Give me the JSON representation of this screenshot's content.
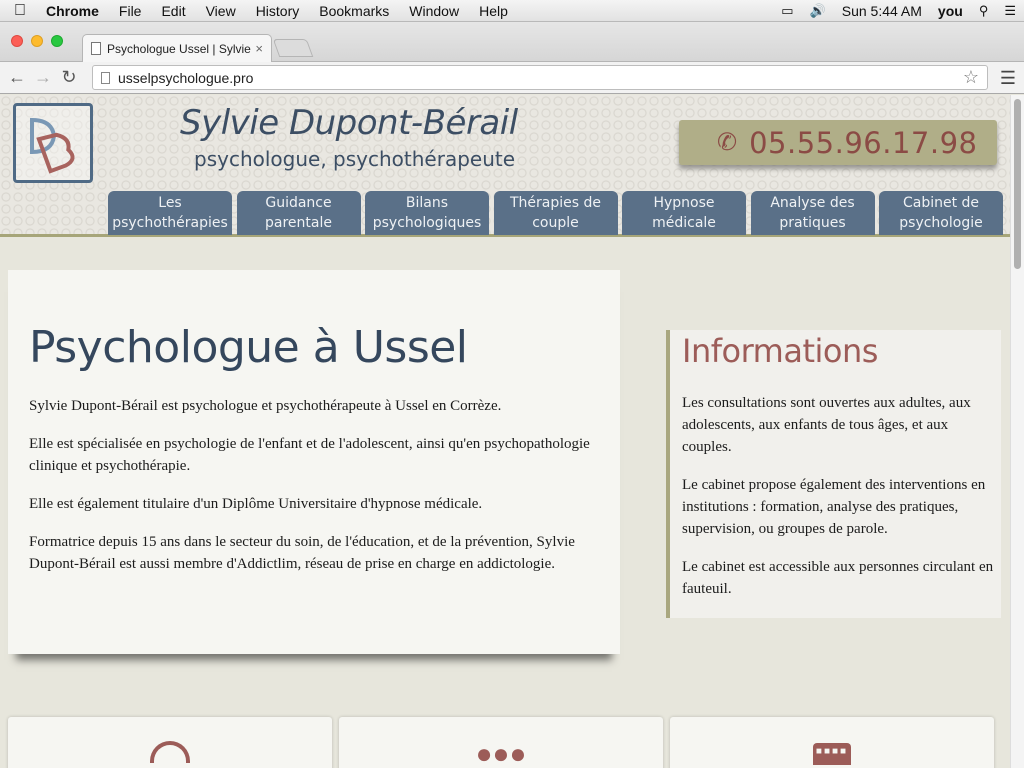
{
  "os_menubar": {
    "app_name": "Chrome",
    "menus": [
      "File",
      "Edit",
      "View",
      "History",
      "Bookmarks",
      "Window",
      "Help"
    ],
    "clock": "Sun 5:44 AM",
    "user": "you"
  },
  "browser": {
    "tab_title": "Psychologue Ussel | Sylvie",
    "tab_close": "×",
    "url": "usselpsychologue.pro"
  },
  "site": {
    "name": "Sylvie Dupont-Bérail",
    "tagline": "psychologue, psychothérapeute",
    "phone": "05.55.96.17.98",
    "logo_letters": "DB",
    "nav": [
      {
        "line1": "Les",
        "line2": "psychothérapies"
      },
      {
        "line1": "Guidance",
        "line2": "parentale"
      },
      {
        "line1": "Bilans",
        "line2": "psychologiques"
      },
      {
        "line1": "Thérapies de",
        "line2": "couple"
      },
      {
        "line1": "Hypnose",
        "line2": "médicale"
      },
      {
        "line1": "Analyse des",
        "line2": "pratiques"
      },
      {
        "line1": "Cabinet de",
        "line2": "psychologie"
      }
    ]
  },
  "main": {
    "title": "Psychologue à Ussel",
    "paragraphs": [
      "Sylvie Dupont-Bérail est psychologue et psychothérapeute à Ussel en Corrèze.",
      "Elle est spécialisée en psychologie de l'enfant et de l'adolescent, ainsi qu'en psychopathologie clinique et psychothérapie.",
      "Elle est également titulaire d'un Diplôme Universitaire d'hypnose médicale.",
      "Formatrice depuis 15 ans dans le secteur du soin, de l'éducation, et de la prévention, Sylvie Dupont-Bérail est aussi membre d'Addictlim, réseau de prise en charge en addictologie."
    ]
  },
  "info": {
    "title": "Informations",
    "paragraphs": [
      "Les consultations sont ouvertes aux adultes, aux adolescents, aux enfants de tous âges, et aux couples.",
      "Le cabinet propose également des interventions en institutions : formation, analyse des pratiques, supervision, ou groupes de parole.",
      "Le cabinet est accessible aux personnes circulant en fauteuil."
    ]
  },
  "feature_icons": [
    "speech-bubble-icon",
    "people-icon",
    "calendar-icon"
  ],
  "colors": {
    "nav_bg": "#5a7088",
    "title_blue": "#35475d",
    "accent_rose": "#9c5c58",
    "phone_bg": "#b0ae88",
    "page_bg": "#e7e6dc"
  }
}
